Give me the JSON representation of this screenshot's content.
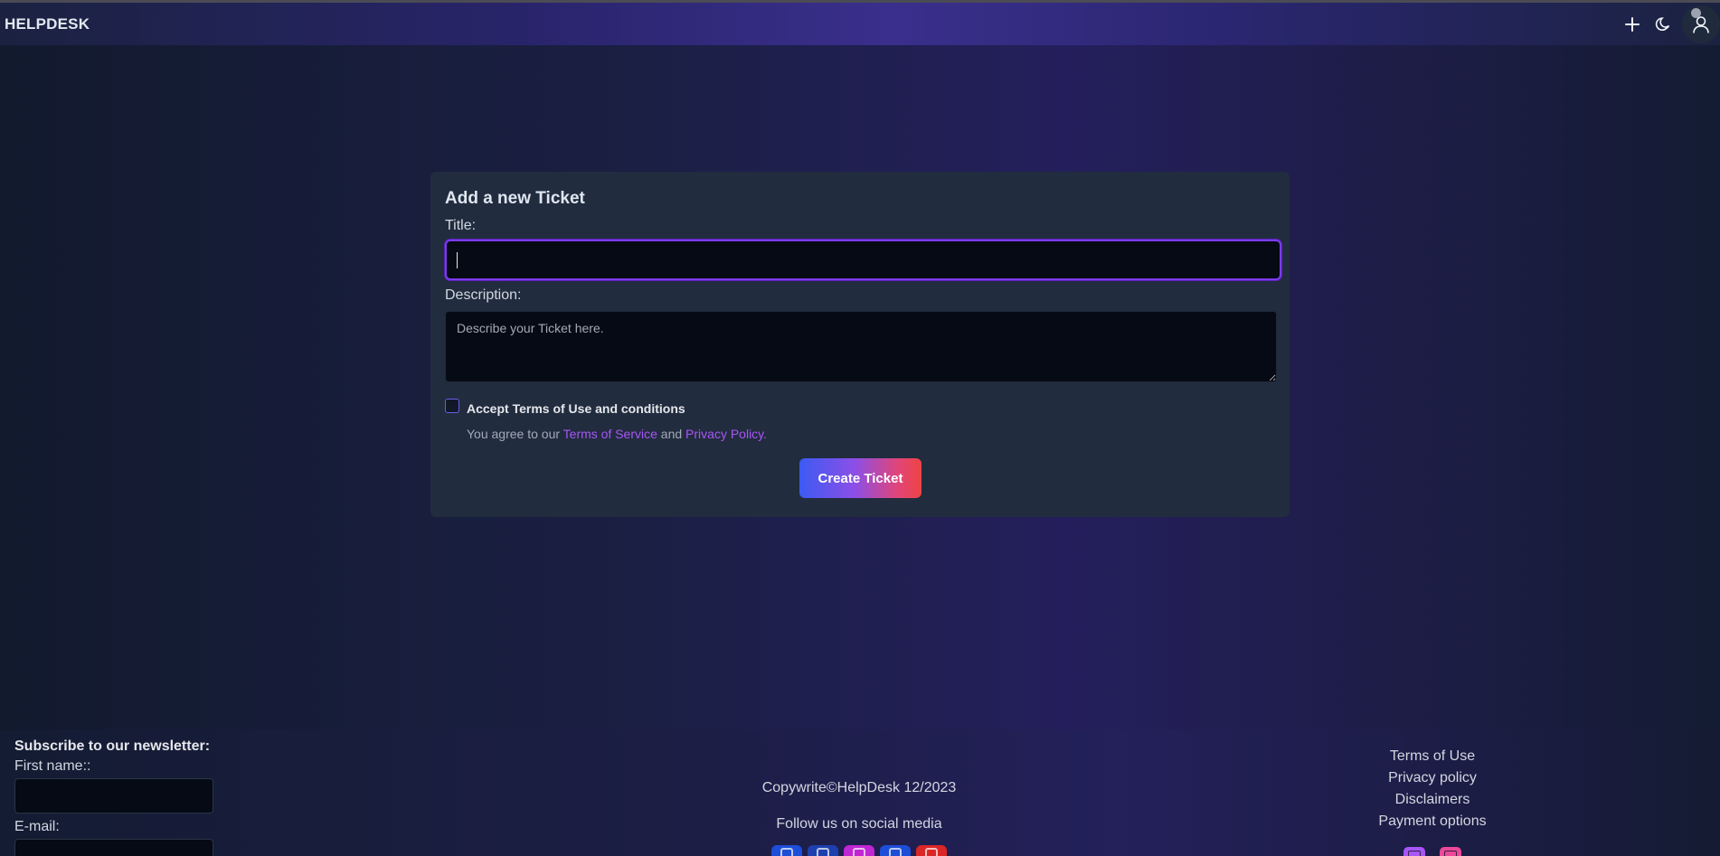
{
  "app": {
    "brand": "HELPDESK"
  },
  "navbar": {
    "icons": [
      "plus-icon",
      "moon-icon",
      "user-icon"
    ]
  },
  "form": {
    "heading": "Add a new Ticket",
    "title_label": "Title:",
    "title_value": "",
    "description_label": "Description:",
    "description_placeholder": "Describe your Ticket here.",
    "terms_label": "Accept Terms of Use and conditions",
    "terms_checked": false,
    "agree_prefix": "You agree to our ",
    "terms_link": "Terms of Service",
    "agree_and": " and ",
    "privacy_link": "Privacy Policy.",
    "submit_label": "Create Ticket"
  },
  "footer": {
    "newsletter_title": "Subscribe to our newsletter:",
    "first_name_label": "First name::",
    "email_label": "E-mail:",
    "copyright": "Copywrite©HelpDesk 12/2023",
    "follow": "Follow us on social media",
    "socials": [
      {
        "name": "linkedin-icon",
        "color": "#1d4ed8"
      },
      {
        "name": "facebook-icon",
        "color": "#1e40af"
      },
      {
        "name": "instagram-icon",
        "color": "#c026d3"
      },
      {
        "name": "twitter-icon",
        "color": "#1d4ed8"
      },
      {
        "name": "youtube-icon",
        "color": "#dc2626"
      }
    ],
    "links": [
      "Terms of Use",
      "Privacy policy",
      "Disclaimers",
      "Payment options"
    ],
    "payment_icons": [
      {
        "name": "credit-card-icon",
        "color": "#a855f7"
      },
      {
        "name": "credit-card-icon",
        "color": "#ec4899"
      }
    ]
  },
  "colors": {
    "accent": "#7c3aed",
    "link": "#a855f7"
  }
}
